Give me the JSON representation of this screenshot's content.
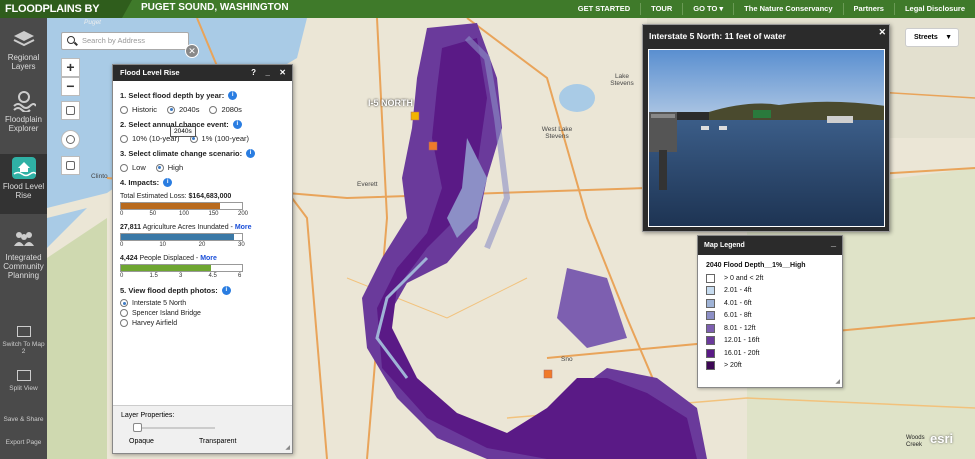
{
  "header": {
    "brand": "FLOODPLAINS BY DESIGN",
    "region": "PUGET SOUND, WASHINGTON",
    "nav": [
      "GET STARTED",
      "TOUR",
      "GO TO ▾",
      "The Nature Conservancy",
      "Partners",
      "Legal Disclosure"
    ]
  },
  "sidebar": {
    "items": [
      {
        "label": "Regional Layers"
      },
      {
        "label": "Floodplain Explorer"
      },
      {
        "label": "Flood Level Rise"
      },
      {
        "label": "Integrated Community Planning"
      }
    ],
    "small": [
      {
        "label": "Switch To Map 2"
      },
      {
        "label": "Split View"
      },
      {
        "label": "Save & Share"
      },
      {
        "label": "Export Page"
      }
    ]
  },
  "search": {
    "placeholder": "Search by Address"
  },
  "map_labels": {
    "i5": "I-5 NORTH",
    "everett": "Everett",
    "lake_stevens": "Lake Stevens",
    "west_lake_stevens": "West Lake Stevens",
    "snohomish": "Sno",
    "clinton": "Clinto",
    "puget": "Puget"
  },
  "panel": {
    "title": "Flood Level Rise",
    "q1": "1. Select flood depth by year:",
    "year_options": [
      "Historic",
      "2040s",
      "2080s"
    ],
    "year_selected": "2040s",
    "q2": "2. Select annual chance event:",
    "event_options": [
      "10% (10-year)",
      "1% (100-year)"
    ],
    "tooltip": "2040s",
    "q3": "3. Select climate change scenario:",
    "scenario_options": [
      "Low",
      "High"
    ],
    "q4": "4. Impacts:",
    "loss_label": "Total Estimated Loss:",
    "loss_value": "$164,683,000",
    "loss_fraction": 0.82,
    "loss_ticks": [
      "0",
      "50",
      "100",
      "150",
      "200"
    ],
    "ag_value": "27,811",
    "ag_label": "Agriculture Acres Inundated -",
    "ag_more": "More",
    "ag_fraction": 0.93,
    "ag_ticks": [
      "0",
      "10",
      "20",
      "30"
    ],
    "people_value": "4,424",
    "people_label": "People Displaced -",
    "people_more": "More",
    "people_fraction": 0.74,
    "people_ticks": [
      "0",
      "1.5",
      "3",
      "4.5",
      "6"
    ],
    "q5": "5. View flood depth photos:",
    "photo_options": [
      "Interstate 5 North",
      "Spencer Island Bridge",
      "Harvey Airfield"
    ],
    "layer_properties": "Layer Properties:",
    "opaque": "Opaque",
    "transparent": "Transparent"
  },
  "photo_popup": {
    "title": "Interstate 5 North: 11 feet of water"
  },
  "legend": {
    "header": "Map Legend",
    "title": "2040 Flood Depth__1%__High",
    "rows": [
      {
        "label": "> 0 and < 2ft",
        "color": "#ffffff"
      },
      {
        "label": "2.01 - 4ft",
        "color": "#c6dbef"
      },
      {
        "label": "4.01 - 6ft",
        "color": "#9fb3d6"
      },
      {
        "label": "6.01 - 8ft",
        "color": "#8c8fc6"
      },
      {
        "label": "8.01 - 12ft",
        "color": "#7d5fb0"
      },
      {
        "label": "12.01 - 16ft",
        "color": "#6a3a9b"
      },
      {
        "label": "16.01 - 20ft",
        "color": "#5a1a86"
      },
      {
        "label": "> 20ft",
        "color": "#3c0754"
      }
    ]
  },
  "basemap": {
    "label": "Streets"
  },
  "attribution": {
    "line1": "Woods",
    "line2": "Creek",
    "esri": "esri"
  }
}
